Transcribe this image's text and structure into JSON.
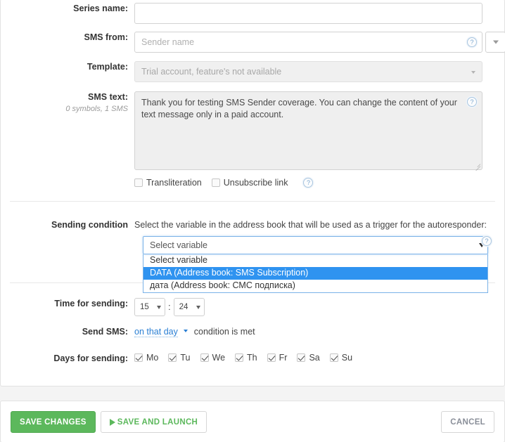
{
  "form": {
    "series_name": {
      "label": "Series name:",
      "value": "",
      "placeholder": ""
    },
    "sms_from": {
      "label": "SMS from:",
      "value": "",
      "placeholder": "Sender name"
    },
    "template": {
      "label": "Template:",
      "value": "Trial account, feature's not available"
    },
    "sms_text": {
      "label": "SMS text:",
      "counter": "0 symbols, 1 SMS",
      "value": "Thank you for testing SMS Sender coverage. You can change the content of your text message only in a paid account."
    },
    "options": {
      "transliteration": {
        "label": "Transliteration",
        "checked": false
      },
      "unsubscribe": {
        "label": "Unsubscribe link",
        "checked": false
      }
    },
    "sending_condition": {
      "label": "Sending condition",
      "description": "Select the variable in the address book that will be used as a trigger for the autoresponder:",
      "selected": "Select variable",
      "options": [
        {
          "text": "Select variable",
          "highlighted": false
        },
        {
          "text": "DATA   (Address book: SMS Subscription)",
          "highlighted": true
        },
        {
          "text": "дата   (Address book: СМС подписка)",
          "highlighted": false
        }
      ]
    },
    "time_for_sending": {
      "label": "Time for sending:",
      "hours": "15",
      "separator": ":",
      "minutes": "24"
    },
    "send_sms": {
      "label": "Send SMS:",
      "link": "on that day",
      "suffix": "condition is met"
    },
    "days_for_sending": {
      "label": "Days for sending:",
      "days": [
        {
          "name": "Mo",
          "checked": true
        },
        {
          "name": "Tu",
          "checked": true
        },
        {
          "name": "We",
          "checked": true
        },
        {
          "name": "Th",
          "checked": true
        },
        {
          "name": "Fr",
          "checked": true
        },
        {
          "name": "Sa",
          "checked": true
        },
        {
          "name": "Su",
          "checked": true
        }
      ]
    }
  },
  "footer": {
    "save_changes": "SAVE CHANGES",
    "save_and_launch": "SAVE AND LAUNCH",
    "cancel": "CANCEL"
  },
  "icons": {
    "help": "?"
  },
  "colors": {
    "accent_green": "#5cb85c",
    "link_blue": "#2a7fd4",
    "highlight_blue": "#2f93f0",
    "focus_border": "#7ab2e8"
  }
}
